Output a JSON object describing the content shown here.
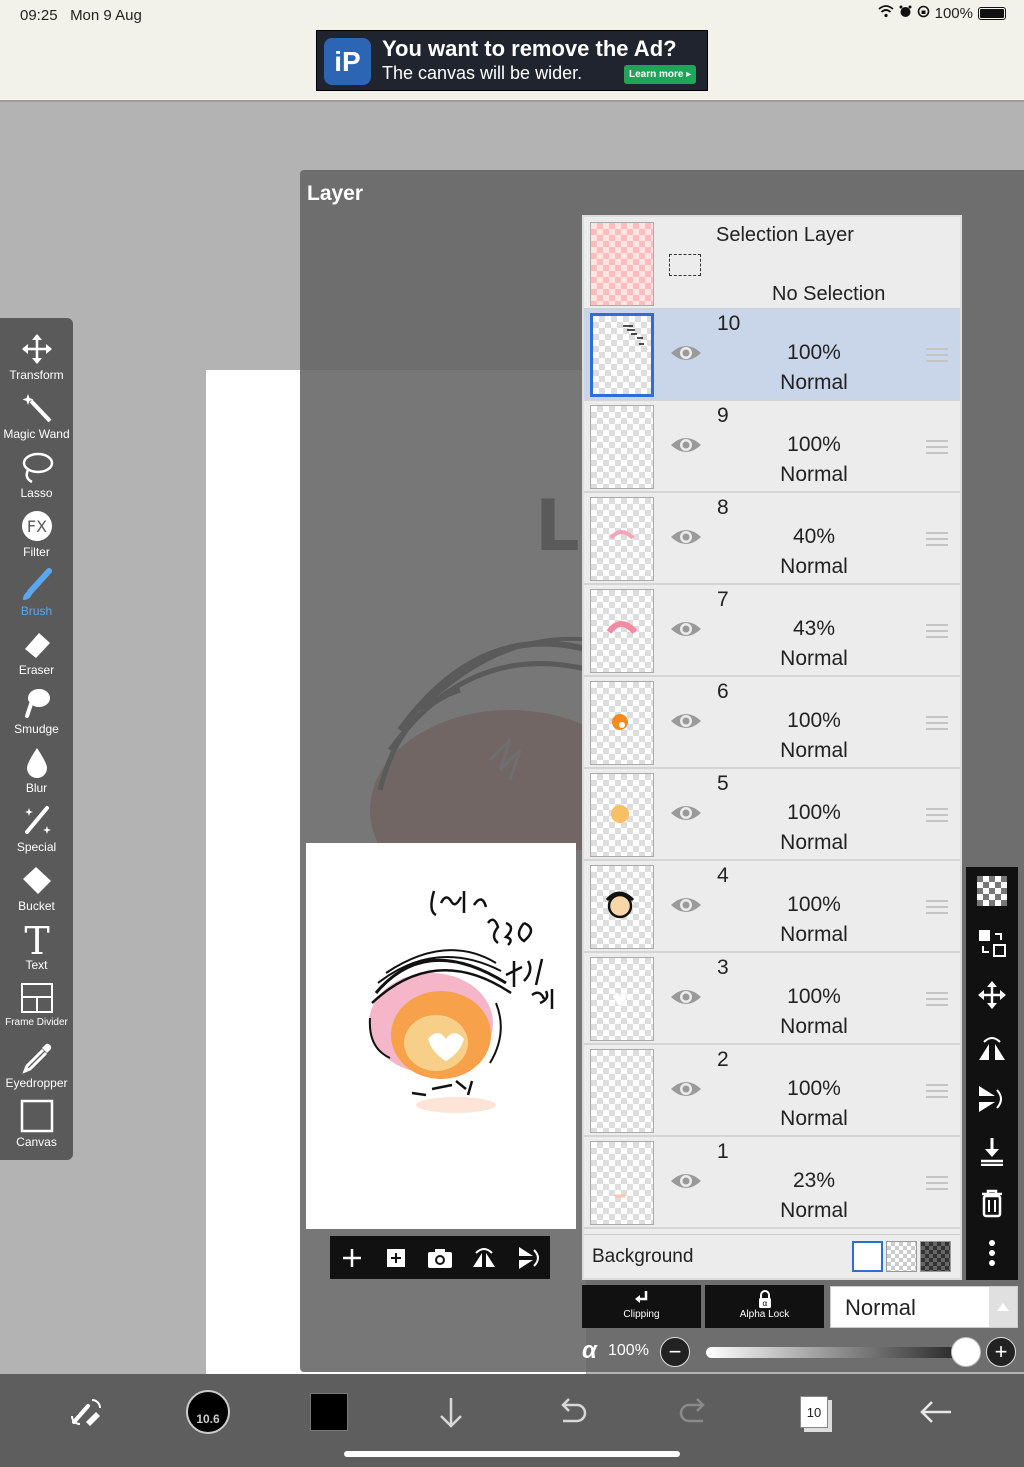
{
  "status_bar": {
    "time": "09:25",
    "date": "Mon 9 Aug",
    "battery": "100%"
  },
  "ad": {
    "logo": "iP",
    "title": "You want to remove the Ad?",
    "subtitle": "The canvas will be wider.",
    "button": "Learn more"
  },
  "layer_panel": {
    "title": "Layer",
    "selection_layer": {
      "title": "Selection Layer",
      "status": "No Selection"
    },
    "layers": [
      {
        "number": "10",
        "opacity": "100%",
        "mode": "Normal"
      },
      {
        "number": "9",
        "opacity": "100%",
        "mode": "Normal"
      },
      {
        "number": "8",
        "opacity": "40%",
        "mode": "Normal"
      },
      {
        "number": "7",
        "opacity": "43%",
        "mode": "Normal"
      },
      {
        "number": "6",
        "opacity": "100%",
        "mode": "Normal"
      },
      {
        "number": "5",
        "opacity": "100%",
        "mode": "Normal"
      },
      {
        "number": "4",
        "opacity": "100%",
        "mode": "Normal"
      },
      {
        "number": "3",
        "opacity": "100%",
        "mode": "Normal"
      },
      {
        "number": "2",
        "opacity": "100%",
        "mode": "Normal"
      },
      {
        "number": "1",
        "opacity": "23%",
        "mode": "Normal"
      }
    ],
    "background_label": "Background",
    "clipping_label": "Clipping",
    "alpha_lock_label": "Alpha Lock",
    "blend_mode": "Normal",
    "alpha_symbol": "α",
    "alpha_value": "100%",
    "alpha_fraction": 1.0
  },
  "tools": [
    {
      "label": "Transform",
      "icon": "move-arrows-icon"
    },
    {
      "label": "Magic Wand",
      "icon": "magic-wand-icon"
    },
    {
      "label": "Lasso",
      "icon": "lasso-icon"
    },
    {
      "label": "Filter",
      "icon": "fx-icon"
    },
    {
      "label": "Brush",
      "icon": "brush-icon"
    },
    {
      "label": "Eraser",
      "icon": "eraser-icon"
    },
    {
      "label": "Smudge",
      "icon": "smudge-icon"
    },
    {
      "label": "Blur",
      "icon": "droplet-icon"
    },
    {
      "label": "Special",
      "icon": "sparkle-brush-icon"
    },
    {
      "label": "Bucket",
      "icon": "bucket-icon"
    },
    {
      "label": "Text",
      "icon": "text-icon"
    },
    {
      "label": "Frame Divider",
      "icon": "frame-divider-icon"
    },
    {
      "label": "Eyedropper",
      "icon": "eyedropper-icon"
    },
    {
      "label": "Canvas",
      "icon": "canvas-icon"
    }
  ],
  "bottom_bar": {
    "brush_size": "10.6",
    "layer_count": "10"
  },
  "canvas_text": {
    "big_letter": "L"
  },
  "colors": {
    "accent": "#2d6fd6",
    "active_tool": "#5aa7ee",
    "ad_button": "#1ea55a"
  }
}
